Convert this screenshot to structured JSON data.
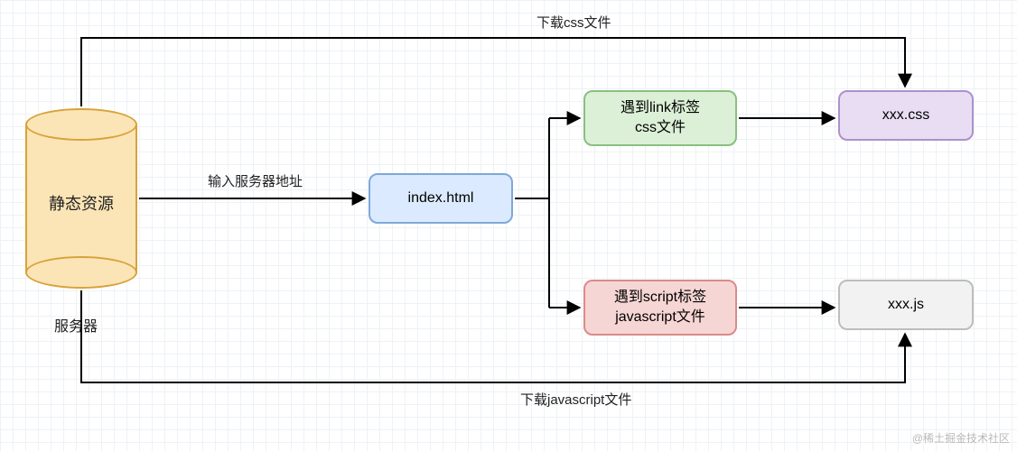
{
  "server": {
    "cylinder_label": "静态资源",
    "caption": "服务器"
  },
  "boxes": {
    "index": "index.html",
    "link": "遇到link标签\ncss文件",
    "script": "遇到script标签\njavascript文件",
    "cssfile": "xxx.css",
    "jsfile": "xxx.js"
  },
  "labels": {
    "input_address": "输入服务器地址",
    "download_css": "下载css文件",
    "download_js": "下载javascript文件"
  },
  "watermark": "@稀土掘金技术社区"
}
